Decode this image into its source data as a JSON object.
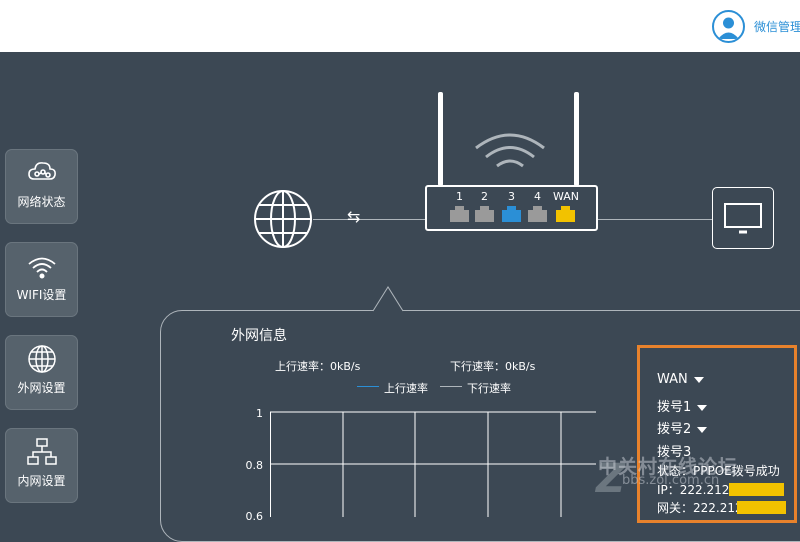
{
  "header": {
    "user_label": "微信管理",
    "avatar_icon": "user-avatar-icon",
    "accent_color": "#2b8fd6"
  },
  "sidebar": {
    "items": [
      {
        "label": "网络状态",
        "icon": "cloud-network-icon"
      },
      {
        "label": "WIFI设置",
        "icon": "wifi-icon"
      },
      {
        "label": "外网设置",
        "icon": "globe-icon"
      },
      {
        "label": "内网设置",
        "icon": "lan-topology-icon"
      }
    ]
  },
  "diagram": {
    "internet_icon": "globe-icon",
    "link_icon": "swap-arrows-icon",
    "swap_glyph": "⇆",
    "ports": [
      {
        "label": "1",
        "color": "#9a9a9a"
      },
      {
        "label": "2",
        "color": "#9a9a9a"
      },
      {
        "label": "3",
        "color": "#2b8fd6"
      },
      {
        "label": "4",
        "color": "#9a9a9a"
      },
      {
        "label": "WAN",
        "color": "#f2c200"
      }
    ],
    "device_icon": "monitor-icon"
  },
  "panel": {
    "title": "外网信息",
    "upload_rate": "上行速率：0kB/s",
    "download_rate": "下行速率：0kB/s",
    "legend": [
      {
        "label": "上行速率",
        "color": "#2b8fd6"
      },
      {
        "label": "下行速率",
        "color": "#aeb5bb"
      }
    ],
    "y_ticks": [
      "1",
      "0.8",
      "0.6"
    ]
  },
  "chart_data": {
    "type": "line",
    "title": "",
    "series": [
      {
        "name": "上行速率",
        "values": []
      },
      {
        "name": "下行速率",
        "values": []
      }
    ],
    "y_ticks": [
      1,
      0.8,
      0.6
    ],
    "grid": true
  },
  "wan": {
    "items": [
      "WAN",
      "拨号1",
      "拨号2"
    ],
    "selected": "拨号3",
    "status": "状态：PPPOE拨号成功",
    "ip": "IP：222.212",
    "gateway": "网关：222.212",
    "border_color": "#e8822c",
    "mask_color": "#f2c200"
  },
  "watermark": {
    "text": "中关村在线论坛",
    "url": "bbs.zol.com.cn"
  }
}
